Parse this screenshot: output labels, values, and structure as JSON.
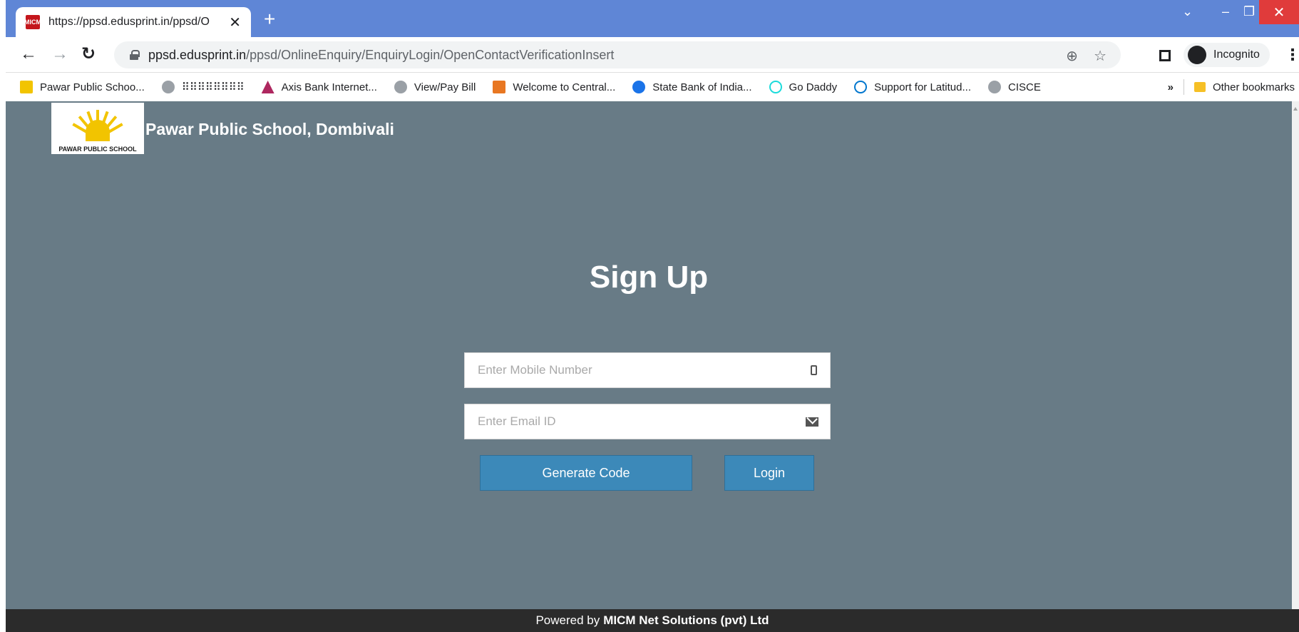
{
  "browser": {
    "tab_title": "https://ppsd.edusprint.in/ppsd/O",
    "tab_favicon": "MICM",
    "url_host": "ppsd.edusprint.in",
    "url_path": "/ppsd/OnlineEnquiry/EnquiryLogin/OpenContactVerificationInsert",
    "incognito_label": "Incognito",
    "bookmarks": [
      {
        "label": "Pawar Public Schoo...",
        "icon": "sun-icon",
        "color": "#f2c400"
      },
      {
        "label": "⠿⠿⠿⠿⠿⠿⠿⠿",
        "icon": "globe-icon",
        "color": "#9aa0a6"
      },
      {
        "label": "Axis Bank Internet...",
        "icon": "axis-icon",
        "color": "#ae275f"
      },
      {
        "label": "View/Pay Bill",
        "icon": "globe-icon",
        "color": "#9aa0a6"
      },
      {
        "label": "Welcome to Central...",
        "icon": "central-icon",
        "color": "#e87722"
      },
      {
        "label": "State Bank of India...",
        "icon": "sbi-icon",
        "color": "#1a73e8"
      },
      {
        "label": "Go Daddy",
        "icon": "godaddy-icon",
        "color": "#1bdbdb"
      },
      {
        "label": "Support for Latitud...",
        "icon": "dell-icon",
        "color": "#0076ce"
      },
      {
        "label": "CISCE",
        "icon": "globe-icon",
        "color": "#9aa0a6"
      }
    ],
    "other_bookmarks": "Other bookmarks"
  },
  "page": {
    "school_name": "Pawar Public School, Dombivali",
    "logo_text": "PAWAR PUBLIC SCHOOL",
    "heading": "Sign Up",
    "mobile_placeholder": "Enter Mobile Number",
    "email_placeholder": "Enter Email ID",
    "generate_button": "Generate Code",
    "login_button": "Login",
    "footer_prefix": "Powered by",
    "footer_company": "MICM Net Solutions (pvt) Ltd"
  },
  "colors": {
    "page_bg": "#687b86",
    "button_bg": "#3c89b9",
    "titlebar": "#5f86d6",
    "footer_bg": "#2b2b2b"
  }
}
